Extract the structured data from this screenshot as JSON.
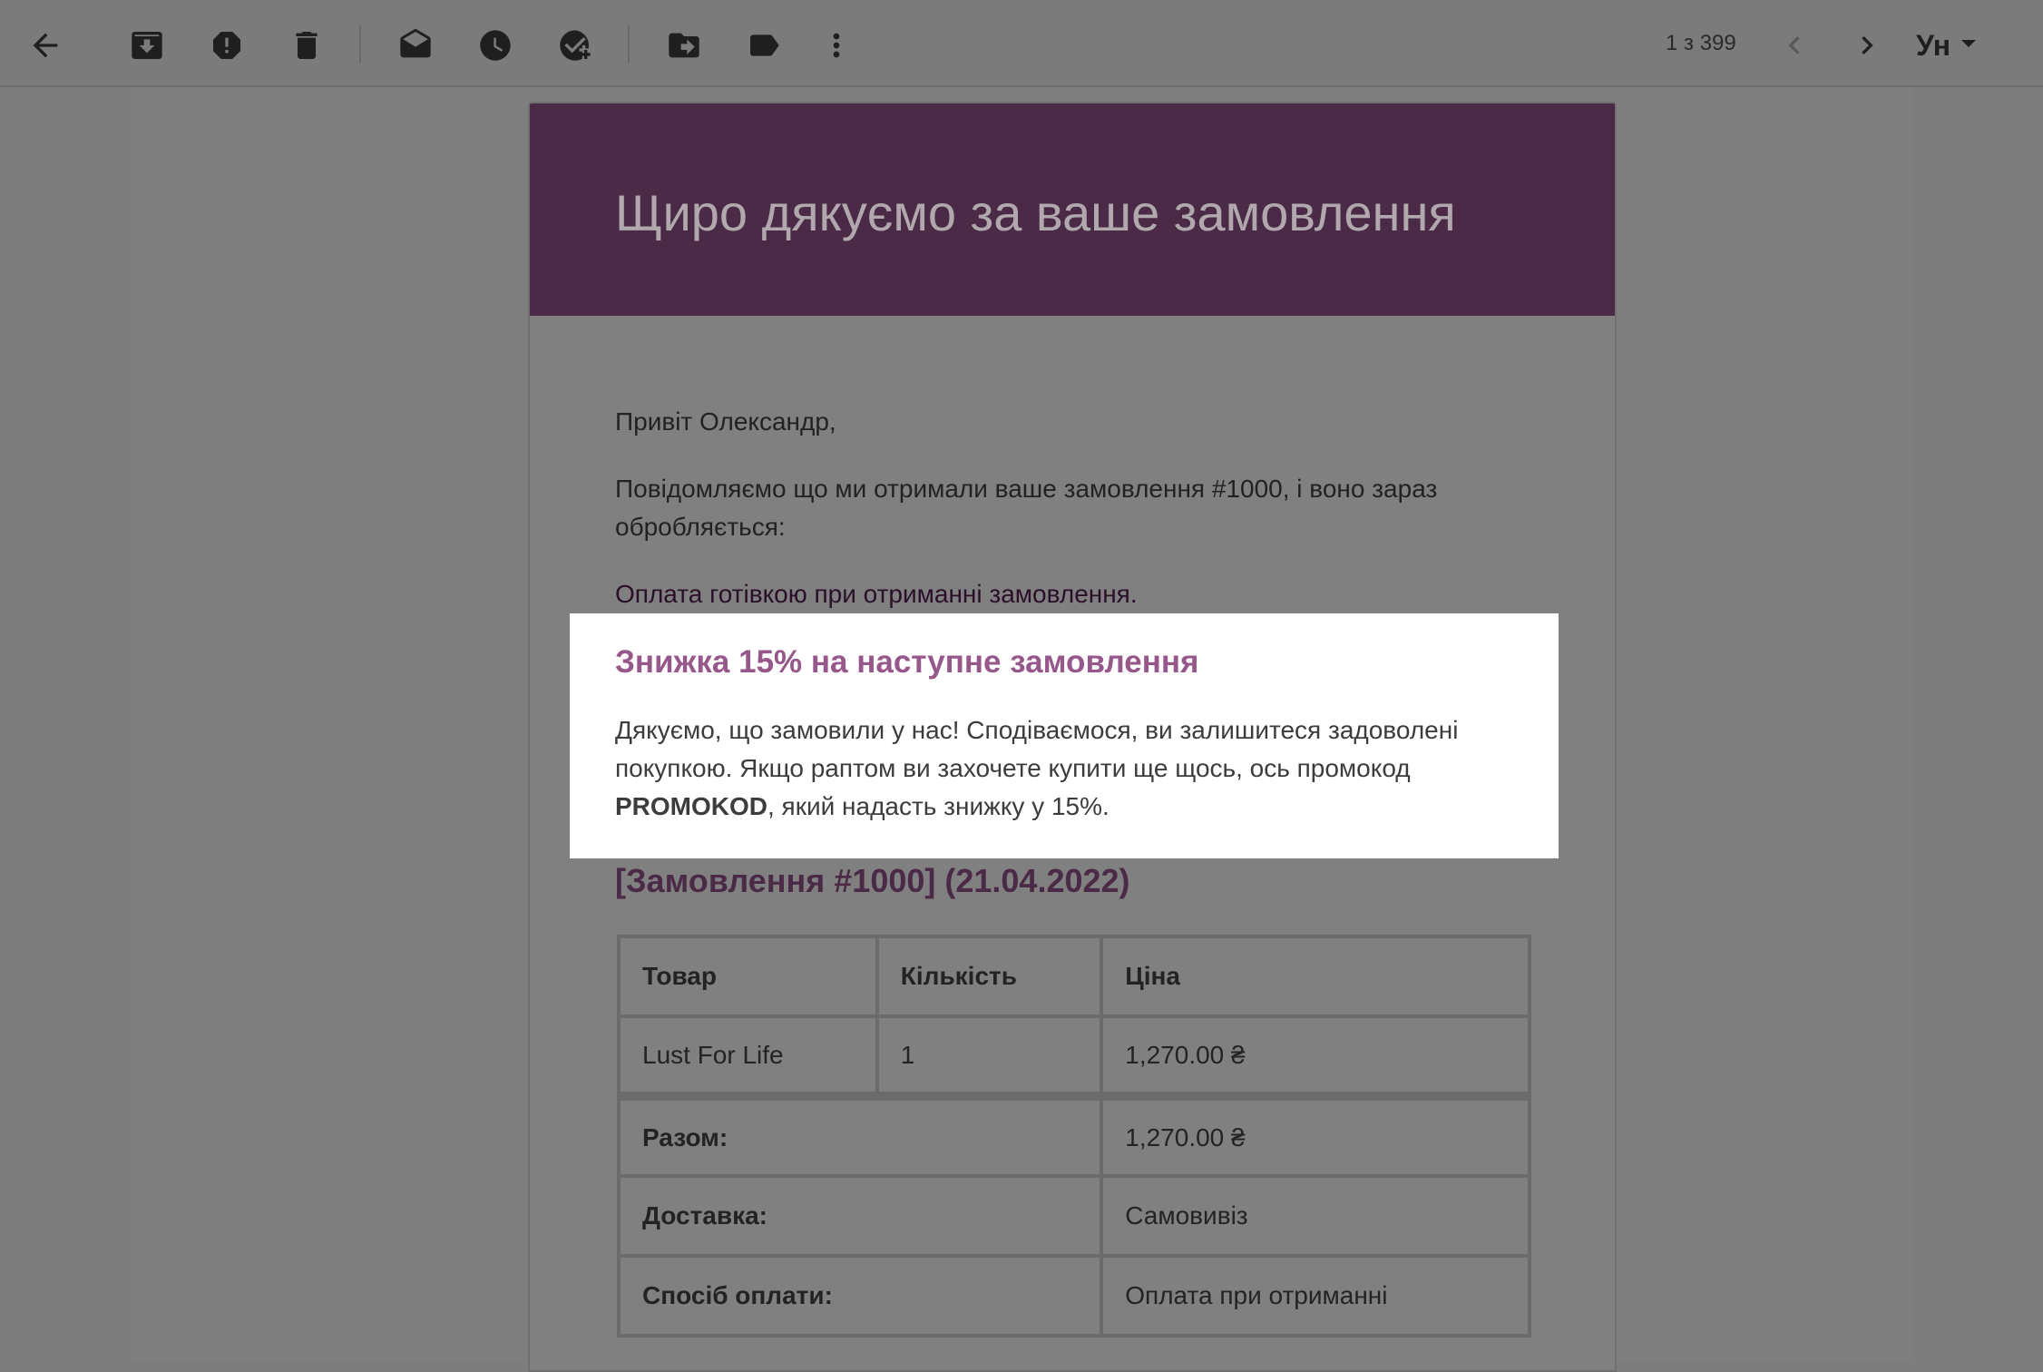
{
  "toolbar": {
    "icons": [
      "back-arrow-icon",
      "archive-icon",
      "report-spam-icon",
      "delete-icon",
      "mark-unread-icon",
      "snooze-icon",
      "add-task-icon",
      "move-to-icon",
      "label-icon",
      "more-vert-icon",
      "prev-chevron-icon",
      "next-chevron-icon"
    ],
    "pager": "1 з 399",
    "language": "Ун"
  },
  "email": {
    "title": "Щиро дякуємо за ваше замовлення",
    "greeting": "Привіт Олександр,",
    "notice": "Повідомляємо що ми отримали ваше замовлення #1000, і воно зараз обробляється:",
    "payment_note": "Оплата готівкою при отриманні замовлення.",
    "order_heading": "[Замовлення #1000] (21.04.2022)",
    "table": {
      "headers": [
        "Товар",
        "Кількість",
        "Ціна"
      ],
      "items": [
        {
          "product": "Lust For Life",
          "qty": "1",
          "price": "1,270.00 ₴"
        }
      ],
      "totals": [
        {
          "label": "Разом:",
          "value": "1,270.00 ₴"
        },
        {
          "label": "Доставка:",
          "value": "Самовивіз"
        },
        {
          "label": "Спосіб оплати:",
          "value": "Оплата при отриманні"
        }
      ]
    }
  },
  "promo": {
    "title": "Знижка 15% на наступне замовлення",
    "text_before": "Дякуємо, що замовили у нас! Сподіваємося, ви залишитеся задоволені покупкою. Якщо раптом ви захочете купити ще щось, ось промокод ",
    "code": "PROMOKOD",
    "text_after": ", який надасть знижку у 15%."
  },
  "colors": {
    "header_bg": "#4a2a47",
    "promo_title": "#96588a",
    "overlay": "#7d7d7d"
  }
}
